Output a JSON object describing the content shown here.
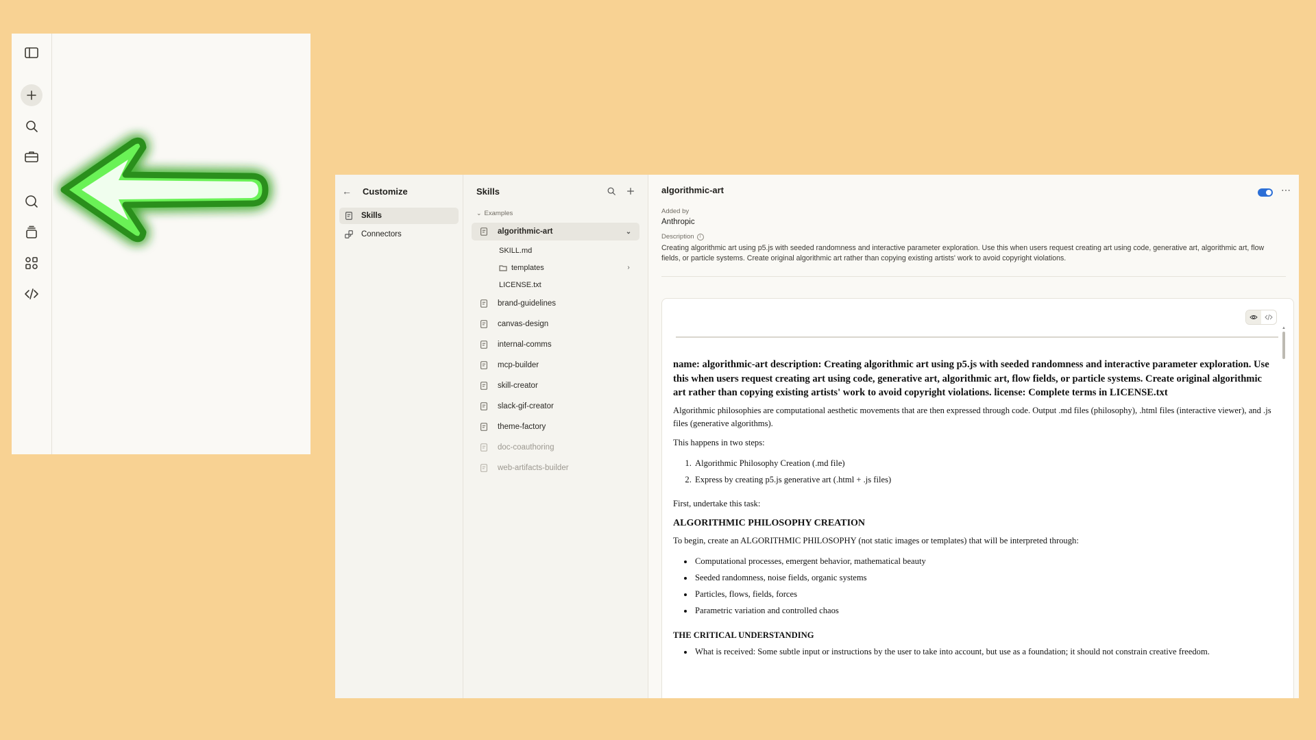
{
  "mini_panel": {
    "rail_icons": [
      "sidebar-toggle-icon",
      "plus-icon",
      "search-icon",
      "briefcase-icon",
      "chat-icon",
      "layers-icon",
      "apps-icon",
      "code-icon"
    ],
    "arrow_color": "#2BE01A"
  },
  "customize": {
    "title": "Customize",
    "nav": [
      {
        "label": "Skills",
        "active": true
      },
      {
        "label": "Connectors",
        "active": false
      }
    ]
  },
  "skills": {
    "title": "Skills",
    "group_label": "Examples",
    "active_skill": {
      "name": "algorithmic-art",
      "files": [
        {
          "name": "SKILL.md"
        },
        {
          "name": "templates",
          "type": "folder"
        },
        {
          "name": "LICENSE.txt"
        }
      ]
    },
    "list": [
      {
        "name": "brand-guidelines",
        "dim": false
      },
      {
        "name": "canvas-design",
        "dim": false
      },
      {
        "name": "internal-comms",
        "dim": false
      },
      {
        "name": "mcp-builder",
        "dim": false
      },
      {
        "name": "skill-creator",
        "dim": false
      },
      {
        "name": "slack-gif-creator",
        "dim": false
      },
      {
        "name": "theme-factory",
        "dim": false
      },
      {
        "name": "doc-coauthoring",
        "dim": true
      },
      {
        "name": "web-artifacts-builder",
        "dim": true
      }
    ]
  },
  "detail": {
    "title": "algorithmic-art",
    "enabled": true,
    "toggle_color": "#2C6FD6",
    "added_by_label": "Added by",
    "added_by": "Anthropic",
    "description_label": "Description",
    "description": "Creating algorithmic art using p5.js with seeded randomness and interactive parameter exploration. Use this when users request creating art using code, generative art, algorithmic art, flow fields, or particle systems. Create original algorithmic art rather than copying existing artists' work to avoid copyright violations."
  },
  "document": {
    "heading": "name: algorithmic-art description: Creating algorithmic art using p5.js with seeded randomness and interactive parameter exploration. Use this when users request creating art using code, generative art, algorithmic art, flow fields, or particle systems. Create original algorithmic art rather than copying existing artists' work to avoid copyright violations. license: Complete terms in LICENSE.txt",
    "intro": "Algorithmic philosophies are computational aesthetic movements that are then expressed through code. Output .md files (philosophy), .html files (interactive viewer), and .js files (generative algorithms).",
    "steps_intro": "This happens in two steps:",
    "steps": [
      "Algorithmic Philosophy Creation (.md file)",
      "Express by creating p5.js generative art (.html + .js files)"
    ],
    "task_intro": "First, undertake this task:",
    "section1_title": "ALGORITHMIC PHILOSOPHY CREATION",
    "section1_intro": "To begin, create an ALGORITHMIC PHILOSOPHY (not static images or templates) that will be interpreted through:",
    "section1_items": [
      "Computational processes, emergent behavior, mathematical beauty",
      "Seeded randomness, noise fields, organic systems",
      "Particles, flows, fields, forces",
      "Parametric variation and controlled chaos"
    ],
    "section2_title": "THE CRITICAL UNDERSTANDING",
    "section2_items": [
      "What is received: Some subtle input or instructions by the user to take into account, but use as a foundation; it should not constrain creative freedom."
    ]
  }
}
